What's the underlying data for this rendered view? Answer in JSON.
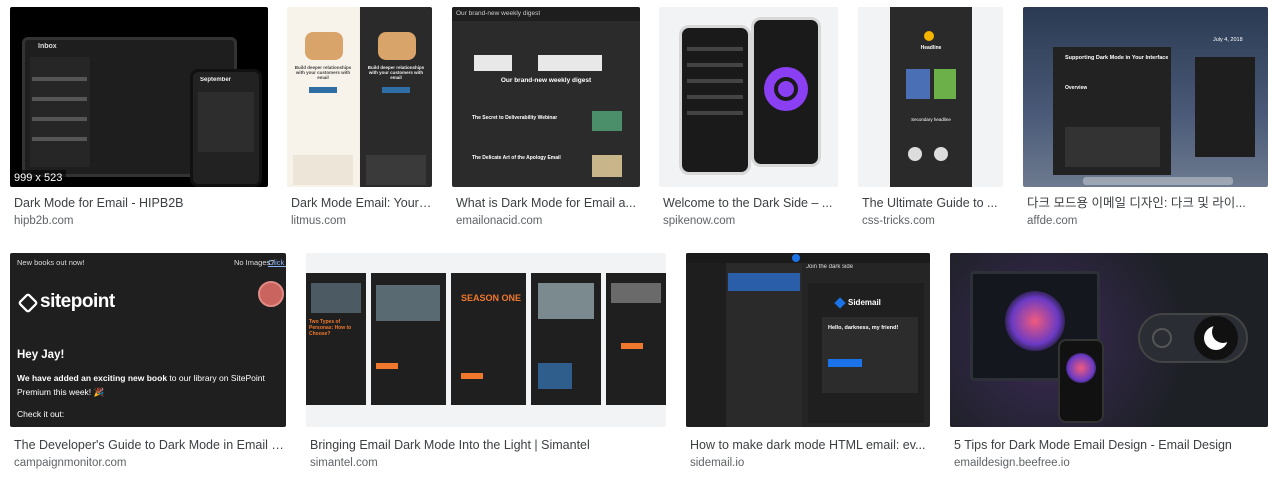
{
  "results": [
    {
      "title": "Dark Mode for Email - HIPB2B",
      "source": "hipb2b.com",
      "dimensions": "999 x 523",
      "thumb_texts": {
        "inbox": "Inbox",
        "month": "September"
      }
    },
    {
      "title": "Dark Mode Email: Your ...",
      "source": "litmus.com",
      "thumb_texts": {
        "headline_a": "Build deeper relationships with your customers with email",
        "headline_b": "Build deeper relationships with your customers with email"
      }
    },
    {
      "title": "What is Dark Mode for Email a...",
      "source": "emailonacid.com",
      "thumb_texts": {
        "header": "Our brand-new weekly digest",
        "digest": "Our brand-new weekly digest",
        "sec1": "The Secret to Deliverability Webinar",
        "sec2": "The Delicate Art of the Apology Email"
      }
    },
    {
      "title": "Welcome to the Dark Side – ...",
      "source": "spikenow.com"
    },
    {
      "title": "The Ultimate Guide to ...",
      "source": "css-tricks.com",
      "thumb_texts": {
        "headline": "Headline",
        "secondary": "Secondary headline"
      }
    },
    {
      "title": "다크 모드용 이메일 디자인: 다크 및 라이...",
      "source": "affde.com",
      "thumb_texts": {
        "heading": "Supporting Dark Mode in Your Interface",
        "overview": "Overview",
        "date": "July 4, 2018"
      }
    },
    {
      "title": "The Developer's Guide to Dark Mode in Email | ...",
      "source": "campaignmonitor.com",
      "thumb_texts": {
        "new_books": "New books out now!",
        "no_images": "No Images?",
        "click": "Click h",
        "brand": "sitepoint",
        "greeting": "Hey Jay!",
        "body_bold": "We have added an exciting new book",
        "body_rest": "to our library on SitePoint",
        "body_line2": "Premium this week! 🎉",
        "check": "Check it out:"
      }
    },
    {
      "title": "Bringing Email Dark Mode Into the Light | Simantel",
      "source": "simantel.com",
      "thumb_texts": {
        "p1": "Two Types of Personas: How to Choose?",
        "p3": "SEASON ONE"
      }
    },
    {
      "title": "How to make dark mode HTML email: ev...",
      "source": "sidemail.io",
      "thumb_texts": {
        "join": "Join the dark side",
        "brand": "Sidemail",
        "hello": "Hello, darkness, my friend!"
      }
    },
    {
      "title": "5 Tips for Dark Mode Email Design - Email Design",
      "source": "emaildesign.beefree.io"
    }
  ],
  "colors": {
    "dark_bg": "#1f1f1f",
    "orange": "#f0782c",
    "blue": "#1a73e8",
    "purple": "#7b3ff2",
    "green": "#2e9d6b"
  }
}
